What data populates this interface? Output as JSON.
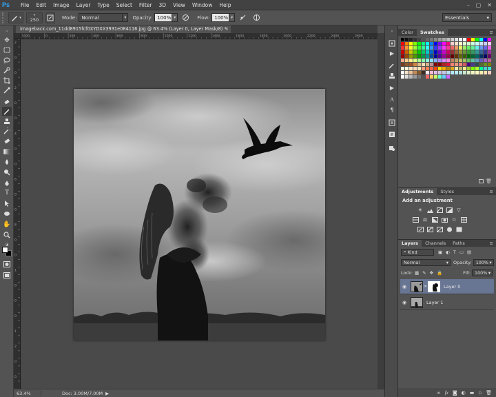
{
  "menubar": {
    "logo": "Ps",
    "items": [
      "File",
      "Edit",
      "Image",
      "Layer",
      "Type",
      "Select",
      "Filter",
      "3D",
      "View",
      "Window",
      "Help"
    ],
    "window_controls": [
      "–",
      "▢",
      "✕"
    ]
  },
  "options": {
    "brush_size": "250",
    "mode_label": "Mode:",
    "mode_value": "Normal",
    "opacity_label": "Opacity:",
    "opacity_value": "100%",
    "flow_label": "Flow:",
    "flow_value": "100%",
    "workspace": "Essentials"
  },
  "document": {
    "tab_title": "imageback.com_11dd8915fcf0XYDXX3931e084116.jpg @ 63.4% (Layer 0, Layer Mask/8) *",
    "close": "×"
  },
  "rulers": {
    "top_ticks": [
      "1000",
      "0",
      "200",
      "400",
      "600",
      "800",
      "1000",
      "1200",
      "1400",
      "1600",
      "1800",
      "2000",
      "2200",
      "2400",
      "2600"
    ],
    "left_ticks": [
      "2",
      "0",
      "0",
      "2",
      "0",
      "0",
      "4",
      "0",
      "0",
      "6",
      "0",
      "0",
      "8",
      "0",
      "0",
      "1",
      "0",
      "0",
      "0",
      "1",
      "2",
      "0",
      "0"
    ]
  },
  "status": {
    "zoom": "63.4%",
    "doc": "Doc: 3.00M/7.00M",
    "arrow": "▶"
  },
  "swatches_panel": {
    "tabs": [
      "Color",
      "Swatches"
    ],
    "active_tab": "Swatches"
  },
  "adjustments_panel": {
    "tabs": [
      "Adjustments",
      "Styles"
    ],
    "active_tab": "Adjustments",
    "title": "Add an adjustment"
  },
  "layers_panel": {
    "tabs": [
      "Layers",
      "Channels",
      "Paths"
    ],
    "active_tab": "Layers",
    "filter_kind": "Kind",
    "blend_mode": "Normal",
    "opacity_label": "Opacity:",
    "opacity_value": "100%",
    "lock_label": "Lock:",
    "fill_label": "Fill:",
    "fill_value": "100%",
    "layers": [
      {
        "name": "Layer 0",
        "selected": true,
        "has_mask": true
      },
      {
        "name": "Layer 1",
        "selected": false,
        "has_mask": false
      }
    ]
  },
  "colors": {
    "ui_bg": "#535353",
    "menubar_bg": "#424242",
    "ps_blue": "#31a8ff",
    "selection": "#687593"
  }
}
